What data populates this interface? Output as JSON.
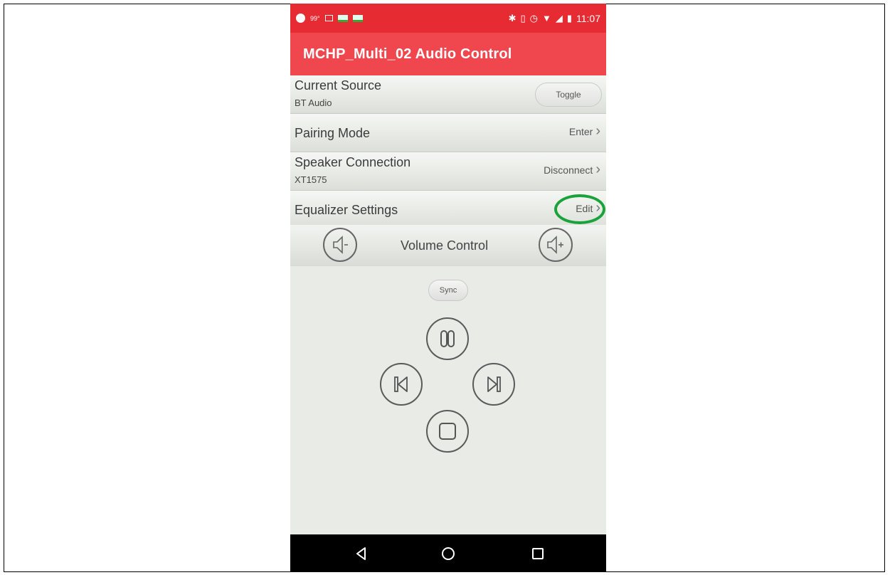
{
  "status_bar": {
    "temperature": "99°",
    "time": "11:07",
    "icons": [
      "notification-icon",
      "image-icon",
      "book-icon",
      "book-icon",
      "bluetooth-icon",
      "vibrate-icon",
      "alarm-icon",
      "wifi-icon",
      "signal-icon",
      "battery-icon"
    ]
  },
  "app_bar": {
    "title": "MCHP_Multi_02 Audio Control"
  },
  "rows": {
    "current_source": {
      "title": "Current Source",
      "subtitle": "BT Audio",
      "action": "Toggle"
    },
    "pairing_mode": {
      "title": "Pairing Mode",
      "action": "Enter"
    },
    "speaker_connection": {
      "title": "Speaker Connection",
      "subtitle": "XT1575",
      "action": "Disconnect"
    },
    "equalizer_settings": {
      "title": "Equalizer Settings",
      "action": "Edit"
    }
  },
  "volume": {
    "label": "Volume Control",
    "icons": [
      "volume-down-icon",
      "volume-up-icon"
    ]
  },
  "playback": {
    "sync_label": "Sync",
    "icons": [
      "pause-icon",
      "previous-icon",
      "next-icon",
      "stop-icon"
    ]
  },
  "nav_bar": {
    "icons": [
      "back-icon",
      "home-icon",
      "recents-icon"
    ]
  },
  "colors": {
    "status_bar": "#e62b32",
    "app_bar": "#f0474f",
    "highlight_circle": "#1aa33a",
    "background": "#e9ebe7",
    "nav_bar": "#000000"
  }
}
